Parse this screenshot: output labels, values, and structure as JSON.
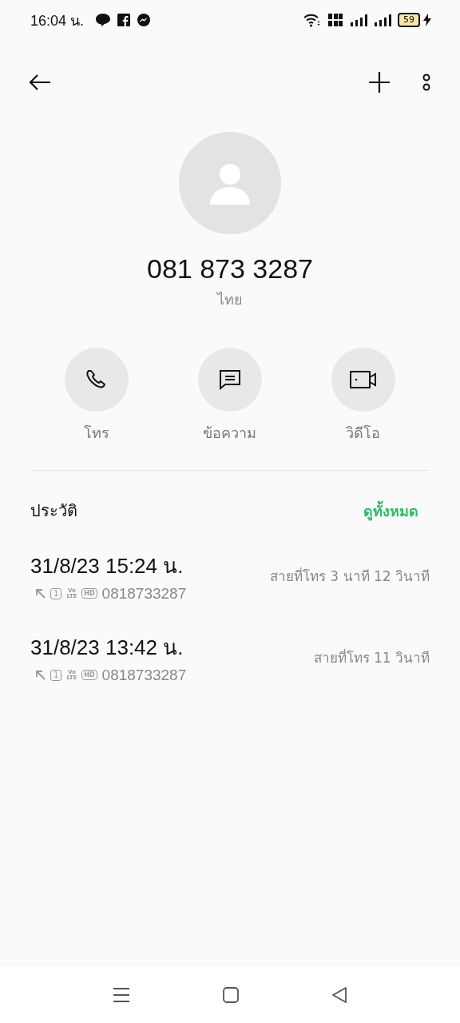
{
  "status_bar": {
    "time": "16:04 น.",
    "battery": "59",
    "charging": true
  },
  "contact": {
    "number": "081 873 3287",
    "country": "ไทย"
  },
  "actions": [
    {
      "kind": "call",
      "label": "โทร"
    },
    {
      "kind": "message",
      "label": "ข้อความ"
    },
    {
      "kind": "video",
      "label": "วิดีโอ"
    }
  ],
  "history": {
    "title": "ประวัติ",
    "see_all": "ดูทั้งหมด",
    "calls": [
      {
        "datetime": "31/8/23 15:24 น.",
        "sim": "1",
        "network_top": "Vo",
        "network_bottom": "LTE",
        "quality": "HD",
        "number": "0818733287",
        "duration": "สายที่โทร  3 นาที 12 วินาที"
      },
      {
        "datetime": "31/8/23 13:42 น.",
        "sim": "1",
        "network_top": "Vo",
        "network_bottom": "LTE",
        "quality": "HD",
        "number": "0818733287",
        "duration": "สายที่โทร  11 วินาที"
      }
    ]
  }
}
